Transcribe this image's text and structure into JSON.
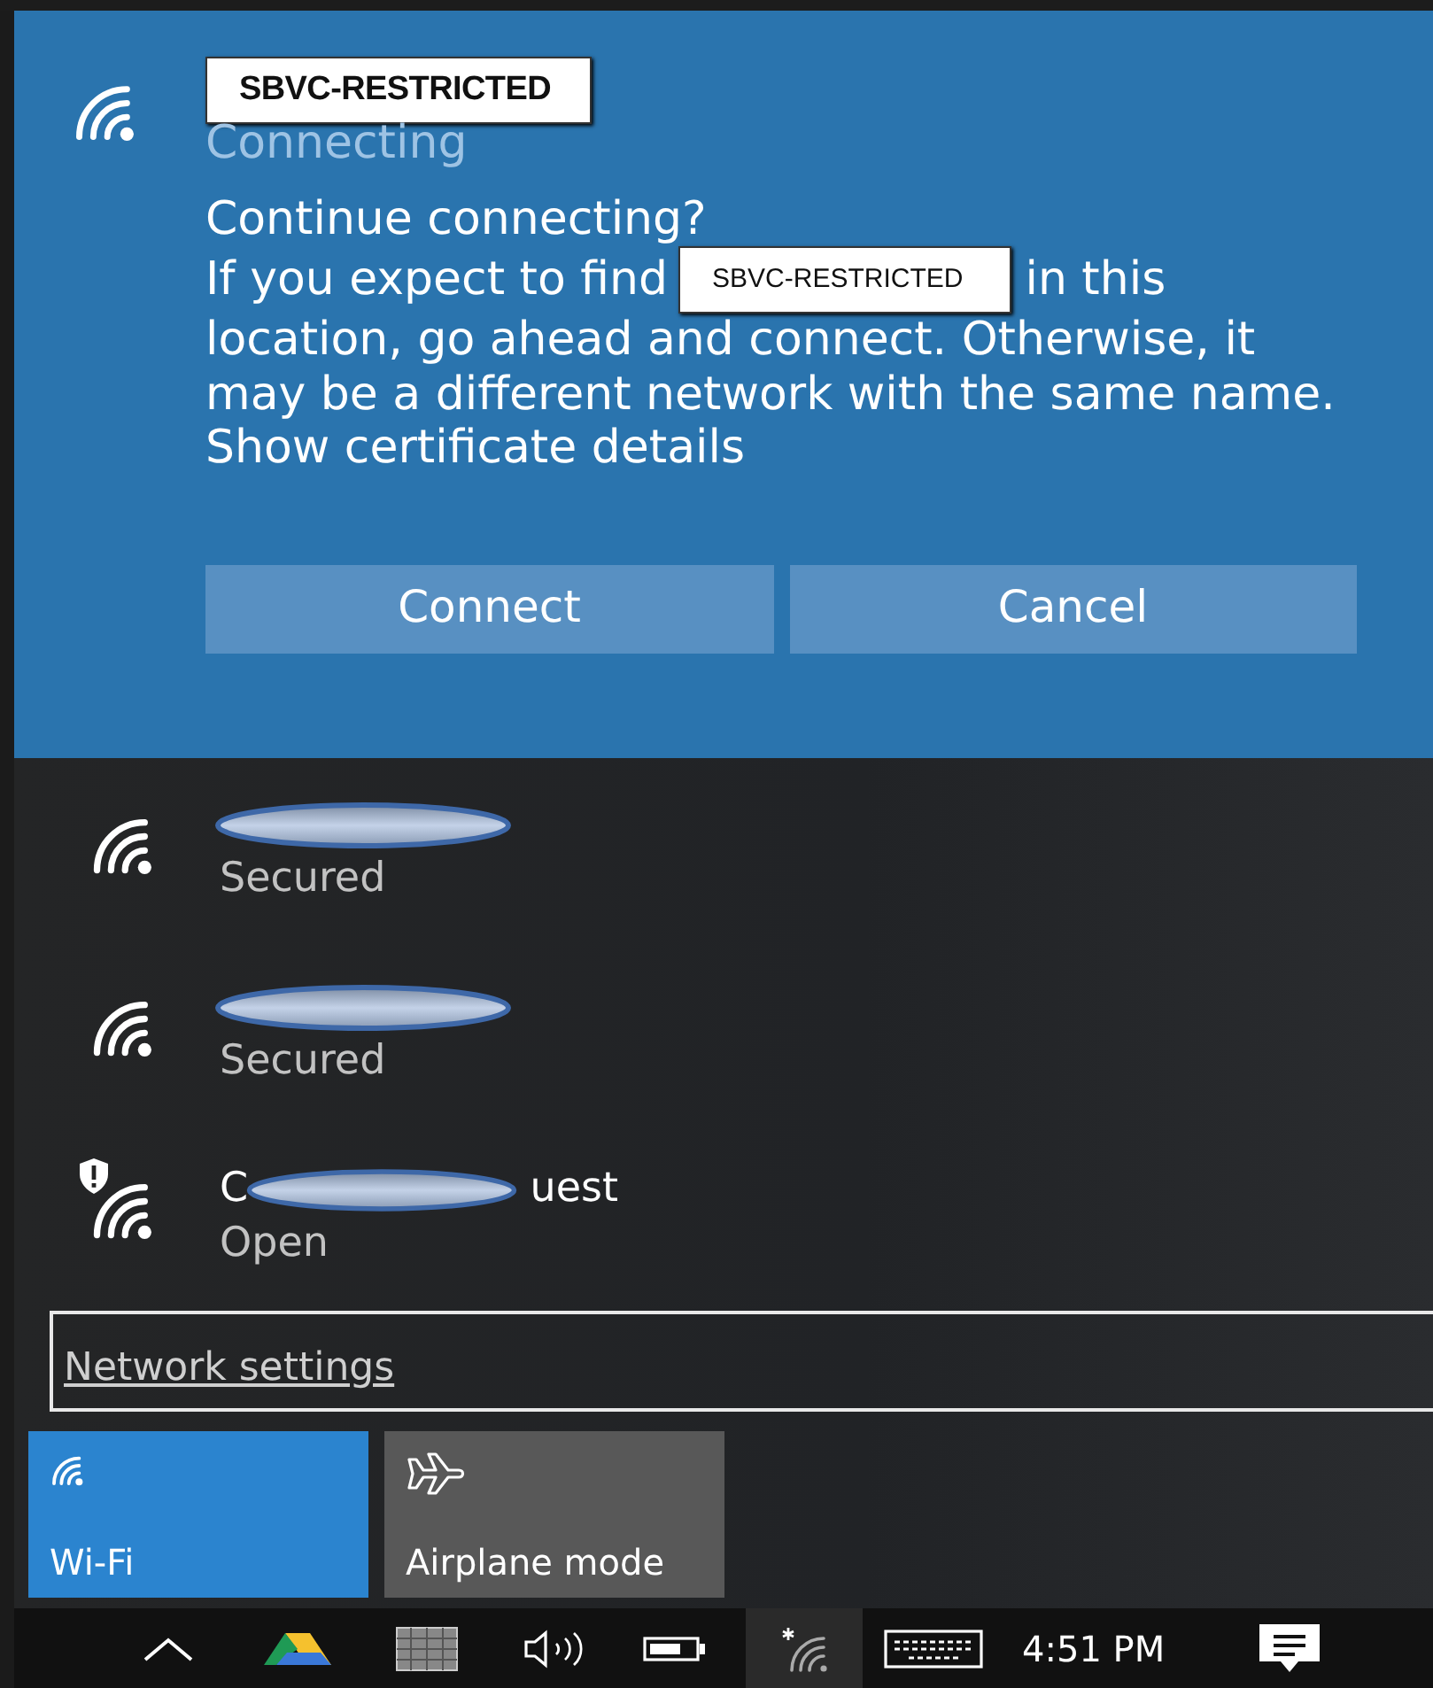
{
  "connecting_network": {
    "name": "SBVC-RESTRICTED",
    "status": "Connecting",
    "prompt": {
      "heading": "Continue connecting?",
      "text_before": "If you expect to find",
      "network_name": "SBVC-RESTRICTED",
      "line_end": "in this",
      "continuation": "location, go ahead and connect. Otherwise, it may be a different network with the same name."
    },
    "link": "Show certificate details",
    "buttons": [
      "Connect",
      "Cancel"
    ]
  },
  "networks": [
    {
      "status": "Secured",
      "secure": true
    },
    {
      "status": "Secured",
      "secure": true
    },
    {
      "name_start": "C",
      "name_end": "uest",
      "status": "Open",
      "secure": false
    }
  ],
  "network_settings": "Network settings",
  "quick_actions": [
    {
      "label": "Wi-Fi",
      "kind": "wifi",
      "on": true
    },
    {
      "label": "Airplane mode",
      "kind": "airplane",
      "on": false
    }
  ],
  "taskbar": {
    "clock": "4:51 PM"
  }
}
